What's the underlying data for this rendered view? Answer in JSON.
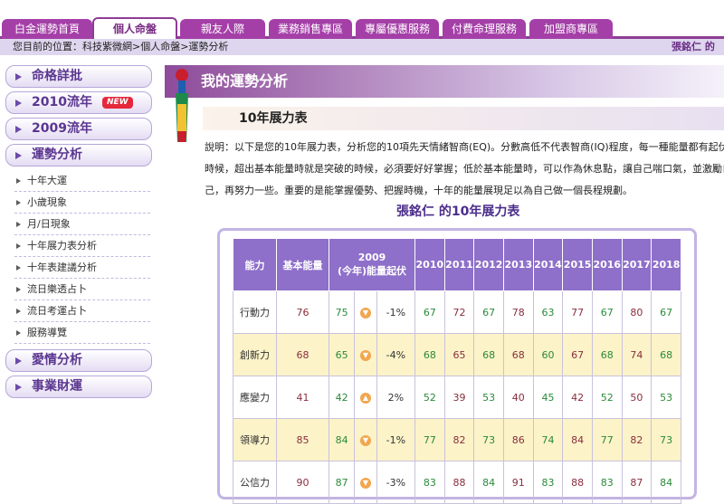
{
  "tabs": [
    "白金運勢首頁",
    "個人命盤",
    "親友人際",
    "業務銷售專區",
    "專屬優惠服務",
    "付費命理服務",
    "加盟商專區"
  ],
  "crumb": "您目前的位置：科技紫微網>個人命盤>運勢分析",
  "user": "張銘仁 的",
  "side": {
    "mingge": "命格詳批",
    "y2010": "2010流年",
    "new_badge": "NEW",
    "y2009": "2009流年",
    "yunshi": "運勢分析",
    "subs": [
      "十年大運",
      "小歲現象",
      "月/日現象",
      "十年展力表分析",
      "十年表建議分析",
      "流日樂透占卜",
      "流日考運占卜",
      "服務導覽"
    ],
    "love": "愛情分析",
    "career": "事業財運"
  },
  "header": "我的運勢分析",
  "subhead": "10年展力表",
  "desc": [
    "說明：以下是您的10年展力表，分析您的10項先天情緒智商(EQ)。分數高低不代表智商(IQ)程度，每一種能量都有起伏的",
    "時候，超出基本能量時就是突破的時候，必須要好好掌握；低於基本能量時，可以作為休息點，讓自己喘口氣，並激勵自",
    "己，再努力一些。重要的是能掌握優勢、把握時機，十年的能量展現足以為自己做一個長程規劃。"
  ],
  "table_title": "張銘仁 的10年展力表",
  "columns": {
    "ability": "能力",
    "base": "基本能量",
    "y2009_1": "2009",
    "y2009_2": "(今年)能量起伏",
    "years": [
      "2010",
      "2011",
      "2012",
      "2013",
      "2014",
      "2015",
      "2016",
      "2017",
      "2018"
    ]
  },
  "rows": [
    {
      "name": "行動力",
      "base": "76",
      "y09": "75",
      "dir": "down",
      "pct": "-1%",
      "vals": [
        "67",
        "72",
        "67",
        "78",
        "63",
        "77",
        "67",
        "80",
        "67"
      ]
    },
    {
      "name": "創新力",
      "base": "68",
      "y09": "65",
      "dir": "down",
      "pct": "-4%",
      "vals": [
        "68",
        "65",
        "68",
        "68",
        "60",
        "67",
        "68",
        "74",
        "68"
      ]
    },
    {
      "name": "應變力",
      "base": "41",
      "y09": "42",
      "dir": "up",
      "pct": "2%",
      "vals": [
        "52",
        "39",
        "53",
        "40",
        "45",
        "42",
        "52",
        "50",
        "53"
      ]
    },
    {
      "name": "領導力",
      "base": "85",
      "y09": "84",
      "dir": "down",
      "pct": "-1%",
      "vals": [
        "77",
        "82",
        "73",
        "86",
        "74",
        "84",
        "77",
        "82",
        "73"
      ]
    },
    {
      "name": "公信力",
      "base": "90",
      "y09": "87",
      "dir": "down",
      "pct": "-3%",
      "vals": [
        "83",
        "88",
        "84",
        "91",
        "83",
        "88",
        "83",
        "87",
        "84"
      ]
    }
  ],
  "colors": {
    "tab": "#a53fa8",
    "header": "#8e4b9a",
    "th": "#8e6fc9",
    "value_brown": "#8a2d3d",
    "value_green": "#2a8a3a"
  }
}
